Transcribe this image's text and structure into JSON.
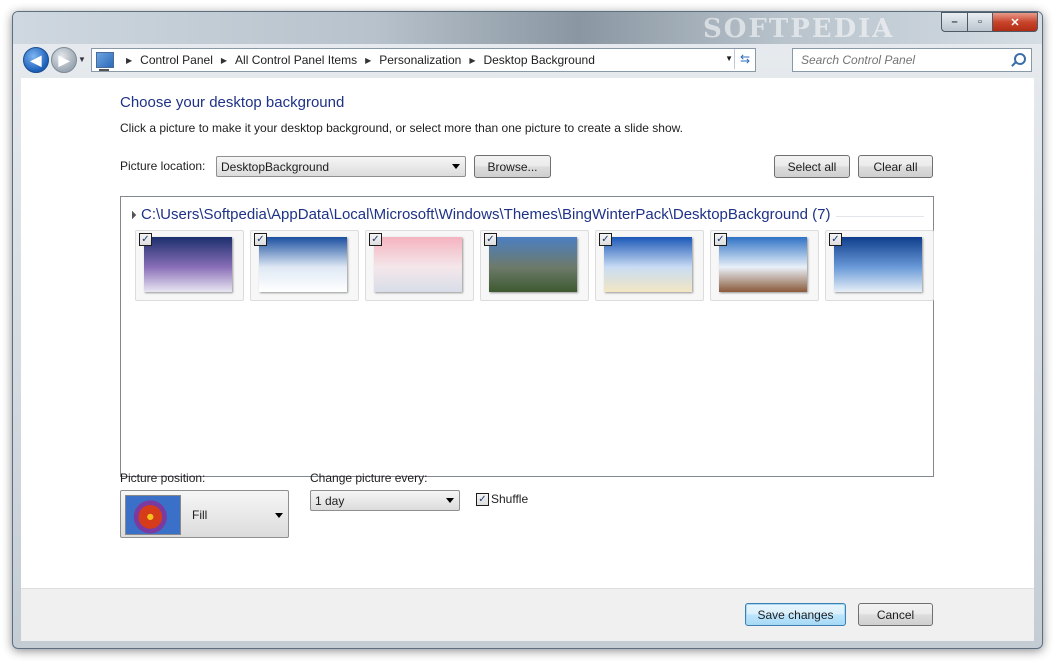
{
  "window": {
    "watermark": "SOFTPEDIA",
    "caption_buttons": {
      "minimize": "–",
      "maximize": "▫",
      "close": "✕"
    }
  },
  "nav": {
    "back_glyph": "◀",
    "forward_glyph": "▶",
    "breadcrumbs": [
      "Control Panel",
      "All Control Panel Items",
      "Personalization",
      "Desktop Background"
    ],
    "search_placeholder": "Search Control Panel",
    "icons": {
      "back": "back-arrow-icon",
      "forward": "forward-arrow-icon",
      "address": "control-panel-icon",
      "refresh": "refresh-icon",
      "search": "search-icon"
    }
  },
  "main": {
    "title": "Choose your desktop background",
    "description": "Click a picture to make it your desktop background, or select more than one picture to create a slide show.",
    "picture_location_label": "Picture location:",
    "picture_location_value": "DesktopBackground",
    "browse_label": "Browse...",
    "select_all_label": "Select all",
    "clear_all_label": "Clear all",
    "group_title": "C:\\Users\\Softpedia\\AppData\\Local\\Microsoft\\Windows\\Themes\\BingWinterPack\\DesktopBackground (7)",
    "thumbnails": [
      {
        "checked": true,
        "colors": [
          "#1b2f6e",
          "#8a6fb8",
          "#e8e6f2"
        ]
      },
      {
        "checked": true,
        "colors": [
          "#1a4fa0",
          "#dfe9f4",
          "#ffffff"
        ]
      },
      {
        "checked": true,
        "colors": [
          "#f5b3c0",
          "#f4e7ea",
          "#d8dde8"
        ]
      },
      {
        "checked": true,
        "colors": [
          "#4b7fc2",
          "#6d7a6a",
          "#3d5a30"
        ]
      },
      {
        "checked": true,
        "colors": [
          "#1b57b8",
          "#c9dcf3",
          "#f3e6c2"
        ]
      },
      {
        "checked": true,
        "colors": [
          "#2f72c5",
          "#e9f0f8",
          "#8a5a3a"
        ]
      },
      {
        "checked": true,
        "colors": [
          "#0f3d8c",
          "#6a9ad8",
          "#e6eef6"
        ]
      }
    ],
    "picture_position_label": "Picture position:",
    "picture_position_value": "Fill",
    "change_picture_label": "Change picture every:",
    "change_picture_value": "1 day",
    "shuffle_label": "Shuffle",
    "shuffle_checked": true
  },
  "footer": {
    "save_label": "Save changes",
    "cancel_label": "Cancel"
  }
}
